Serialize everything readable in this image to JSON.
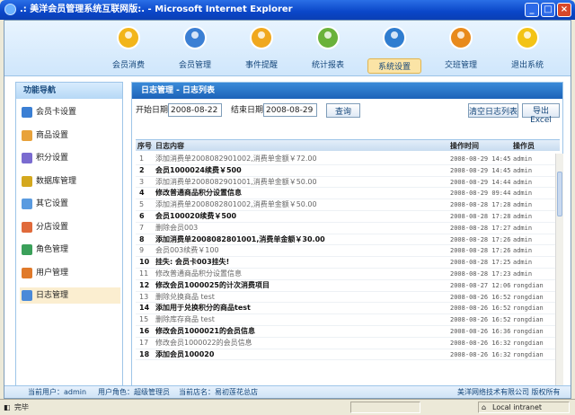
{
  "window": {
    "title": ".: 美洋会员管理系统互联网版:. - Microsoft Internet Explorer"
  },
  "nav": [
    {
      "label": "会员消费",
      "icon": "member-consume-icon",
      "color": "#f2b51a"
    },
    {
      "label": "会员管理",
      "icon": "member-manage-icon",
      "color": "#3b7fd4"
    },
    {
      "label": "事件提醒",
      "icon": "event-reminder-icon",
      "color": "#f0a81e"
    },
    {
      "label": "统计报表",
      "icon": "statistics-report-icon",
      "color": "#6ab23b"
    },
    {
      "label": "系统设置",
      "icon": "system-settings-icon",
      "color": "#2f7dd0"
    },
    {
      "label": "交班管理",
      "icon": "shift-handover-icon",
      "color": "#e88a1c"
    },
    {
      "label": "退出系统",
      "icon": "exit-system-icon",
      "color": "#f3c316"
    }
  ],
  "sidebar": {
    "title": "功能导航",
    "items": [
      {
        "label": "会员卡设置",
        "icon": "card-icon",
        "color": "#3b7fd4"
      },
      {
        "label": "商品设置",
        "icon": "product-icon",
        "color": "#e8a23b"
      },
      {
        "label": "积分设置",
        "icon": "points-icon",
        "color": "#7a6bd0"
      },
      {
        "label": "数据库管理",
        "icon": "database-icon",
        "color": "#d4a81e"
      },
      {
        "label": "其它设置",
        "icon": "other-settings-icon",
        "color": "#5a9be0"
      },
      {
        "label": "分店设置",
        "icon": "branch-icon",
        "color": "#e06a3b"
      },
      {
        "label": "角色管理",
        "icon": "role-icon",
        "color": "#3ba05a"
      },
      {
        "label": "用户管理",
        "icon": "user-icon",
        "color": "#e07a2b"
      },
      {
        "label": "日志管理",
        "icon": "log-icon",
        "color": "#4a8ad8"
      }
    ]
  },
  "main": {
    "title": "日志管理 - 日志列表",
    "start_label": "开始日期",
    "start_value": "2008-08-22",
    "end_label": "结束日期",
    "end_value": "2008-08-29",
    "query_button": "查询",
    "clear_button": "清空日志列表",
    "export_button": "导出Excel",
    "columns": [
      "序号",
      "日志内容",
      "操作时间",
      "操作员"
    ]
  },
  "rows": [
    {
      "no": "1",
      "content": "添加消费单2008082901002,消费单金额￥72.00",
      "time": "2008-08-29 14:45",
      "op": "admin",
      "style": "g"
    },
    {
      "no": "2",
      "content": "会员1000024续费￥500",
      "time": "2008-08-29 14:45",
      "op": "admin",
      "style": "b"
    },
    {
      "no": "3",
      "content": "添加消费单2008082901001,消费单金额￥50.00",
      "time": "2008-08-29 14:44",
      "op": "admin",
      "style": "g"
    },
    {
      "no": "4",
      "content": "修改普通商品积分设置信息",
      "time": "2008-08-29 09:44",
      "op": "admin",
      "style": "b"
    },
    {
      "no": "5",
      "content": "添加消费单2008082801002,消费单金额￥50.00",
      "time": "2008-08-28 17:28",
      "op": "admin",
      "style": "g"
    },
    {
      "no": "6",
      "content": "会员100020续费￥500",
      "time": "2008-08-28 17:28",
      "op": "admin",
      "style": "b"
    },
    {
      "no": "7",
      "content": "删除会员003",
      "time": "2008-08-28 17:27",
      "op": "admin",
      "style": "g"
    },
    {
      "no": "8",
      "content": "添加消费单2008082801001,消费单金额￥30.00",
      "time": "2008-08-28 17:26",
      "op": "admin",
      "style": "b"
    },
    {
      "no": "9",
      "content": "会员003续费￥100",
      "time": "2008-08-28 17:26",
      "op": "admin",
      "style": "g"
    },
    {
      "no": "10",
      "content": "挂失: 会员卡003挂失!",
      "time": "2008-08-28 17:25",
      "op": "admin",
      "style": "b"
    },
    {
      "no": "11",
      "content": "修改普通商品积分设置信息",
      "time": "2008-08-28 17:23",
      "op": "admin",
      "style": "g"
    },
    {
      "no": "12",
      "content": "修改会员1000025的计次消费项目",
      "time": "2008-08-27 12:06",
      "op": "rongdian",
      "style": "b"
    },
    {
      "no": "13",
      "content": "删除兑换商品 test",
      "time": "2008-08-26 16:52",
      "op": "rongdian",
      "style": "g"
    },
    {
      "no": "14",
      "content": "添加用于兑换积分的商品test",
      "time": "2008-08-26 16:52",
      "op": "rongdian",
      "style": "b"
    },
    {
      "no": "15",
      "content": "删除库存商品 test",
      "time": "2008-08-26 16:52",
      "op": "rongdian",
      "style": "g"
    },
    {
      "no": "16",
      "content": "修改会员1000021的会员信息",
      "time": "2008-08-26 16:36",
      "op": "rongdian",
      "style": "b"
    },
    {
      "no": "17",
      "content": "修改会员1000022的会员信息",
      "time": "2008-08-26 16:32",
      "op": "rongdian",
      "style": "g"
    },
    {
      "no": "18",
      "content": "添加会员100020",
      "time": "2008-08-26 16:32",
      "op": "rongdian",
      "style": "b"
    }
  ],
  "footer": {
    "user": "当前用户：admin",
    "role": "用户角色：超级管理员",
    "store": "当前店名：易初莲花总店",
    "copyright": "美洋网络技术有限公司  版权所有"
  },
  "statusbar": {
    "left": "完毕",
    "zone": "Local intranet"
  }
}
